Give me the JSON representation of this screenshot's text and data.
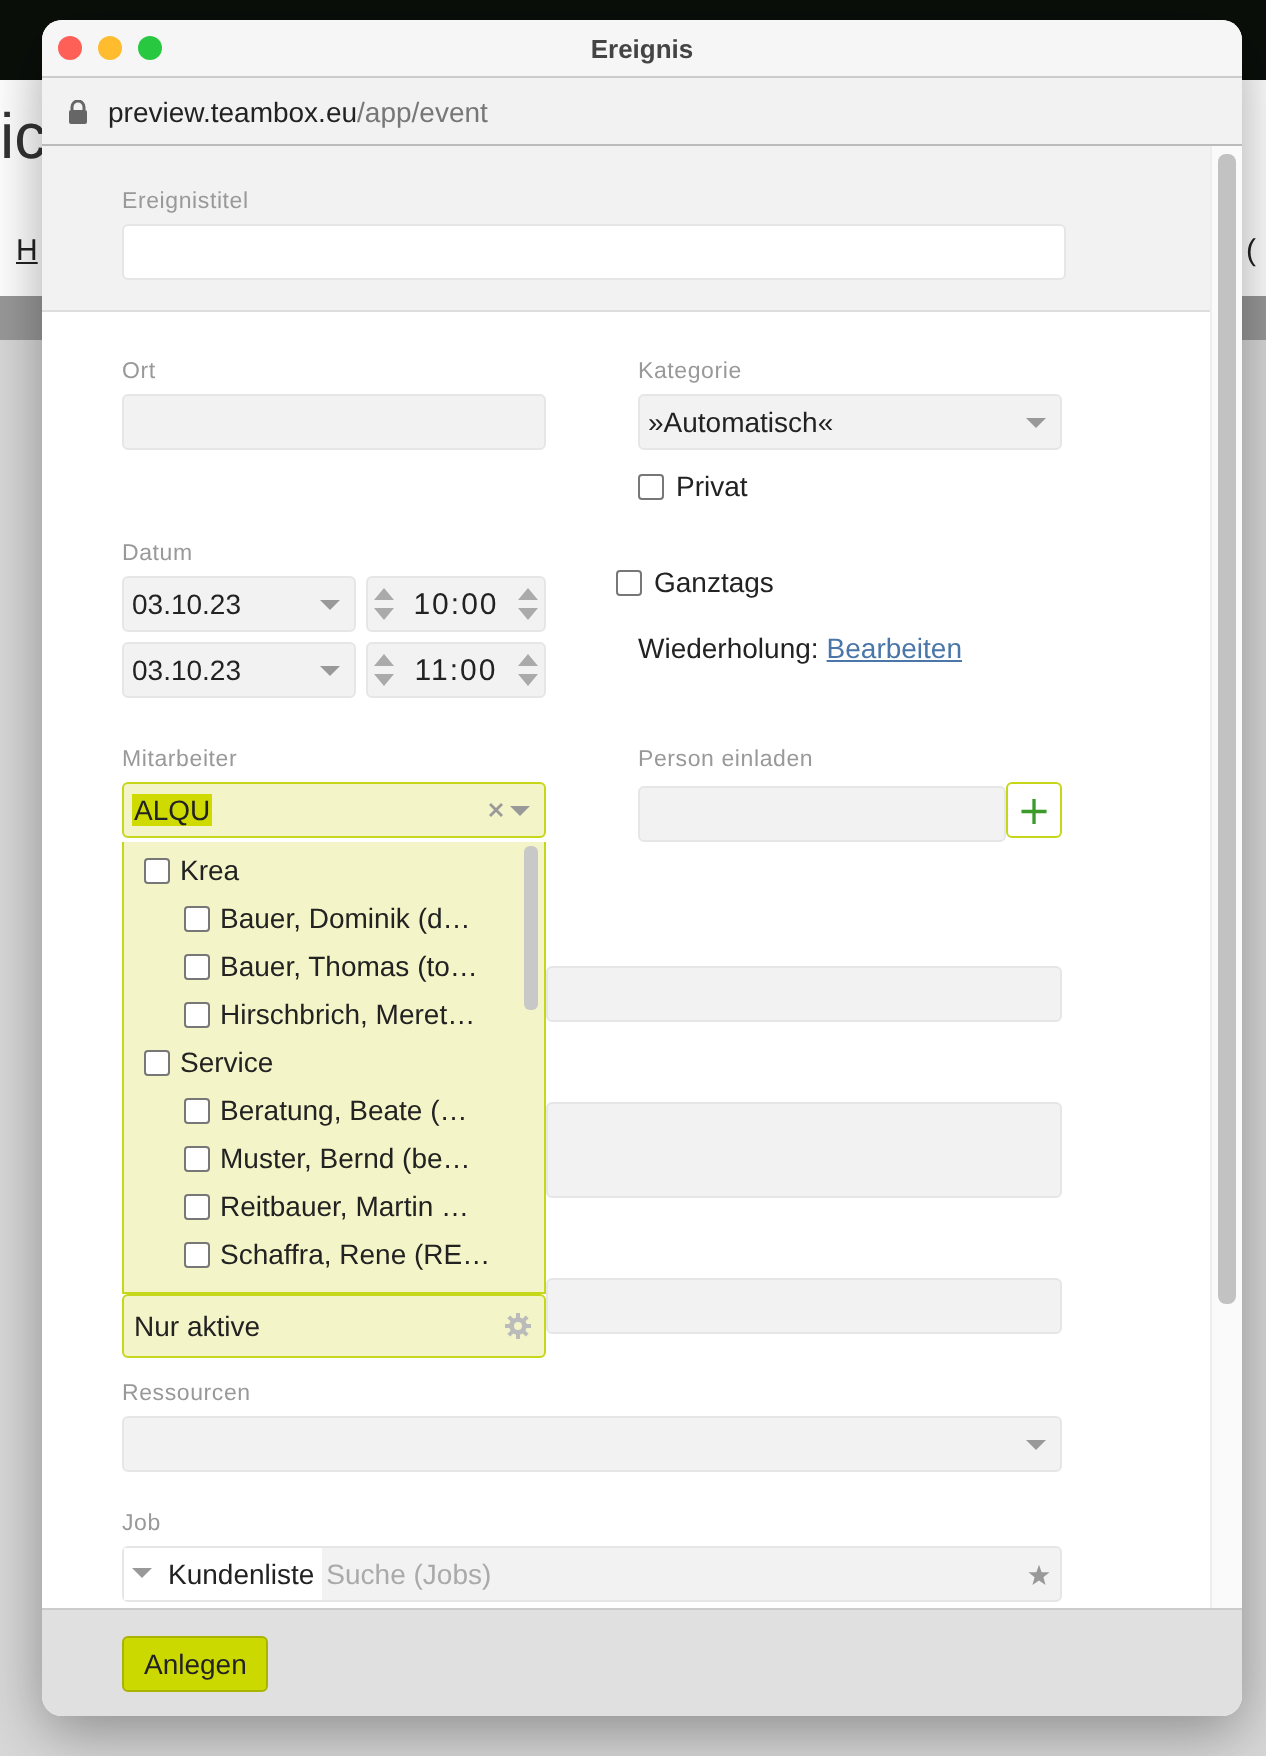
{
  "background": {
    "heading": "ic",
    "link": "H",
    "text": "("
  },
  "window": {
    "title": "Ereignis",
    "url_host": "preview.teambox.eu",
    "url_path": "/app/event"
  },
  "title_field": {
    "label": "Ereignistitel"
  },
  "ort": {
    "label": "Ort"
  },
  "kategorie": {
    "label": "Kategorie",
    "value": "»Automatisch«"
  },
  "privat": {
    "label": "Privat",
    "checked": false
  },
  "datum": {
    "label": "Datum",
    "rows": [
      {
        "date": "03.10.23",
        "time": "10:00"
      },
      {
        "date": "03.10.23",
        "time": "11:00"
      }
    ]
  },
  "ganztags": {
    "label": "Ganztags",
    "checked": false
  },
  "wiederholung": {
    "label": "Wiederholung:",
    "link": "Bearbeiten"
  },
  "mitarbeiter": {
    "label": "Mitarbeiter",
    "value": "ALQU",
    "groups": [
      {
        "label": "Krea",
        "checked": false,
        "children": [
          {
            "label": "Bauer, Dominik (d…",
            "checked": false
          },
          {
            "label": "Bauer, Thomas (to…",
            "checked": false
          },
          {
            "label": "Hirschbrich, Meret…",
            "checked": false
          }
        ]
      },
      {
        "label": "Service",
        "checked": false,
        "children": [
          {
            "label": "Beratung, Beate (…",
            "checked": false
          },
          {
            "label": "Muster, Bernd (be…",
            "checked": false
          },
          {
            "label": "Reitbauer, Martin …",
            "checked": false
          },
          {
            "label": "Schaffra, Rene (RE…",
            "checked": false
          }
        ]
      }
    ],
    "filter": "Nur aktive"
  },
  "person": {
    "label": "Person einladen",
    "add": "+"
  },
  "ressourcen": {
    "label": "Ressourcen"
  },
  "job": {
    "label": "Job",
    "scope": "Kundenliste",
    "placeholder": "Suche (Jobs)"
  },
  "buttons": [
    "Anlegen"
  ]
}
